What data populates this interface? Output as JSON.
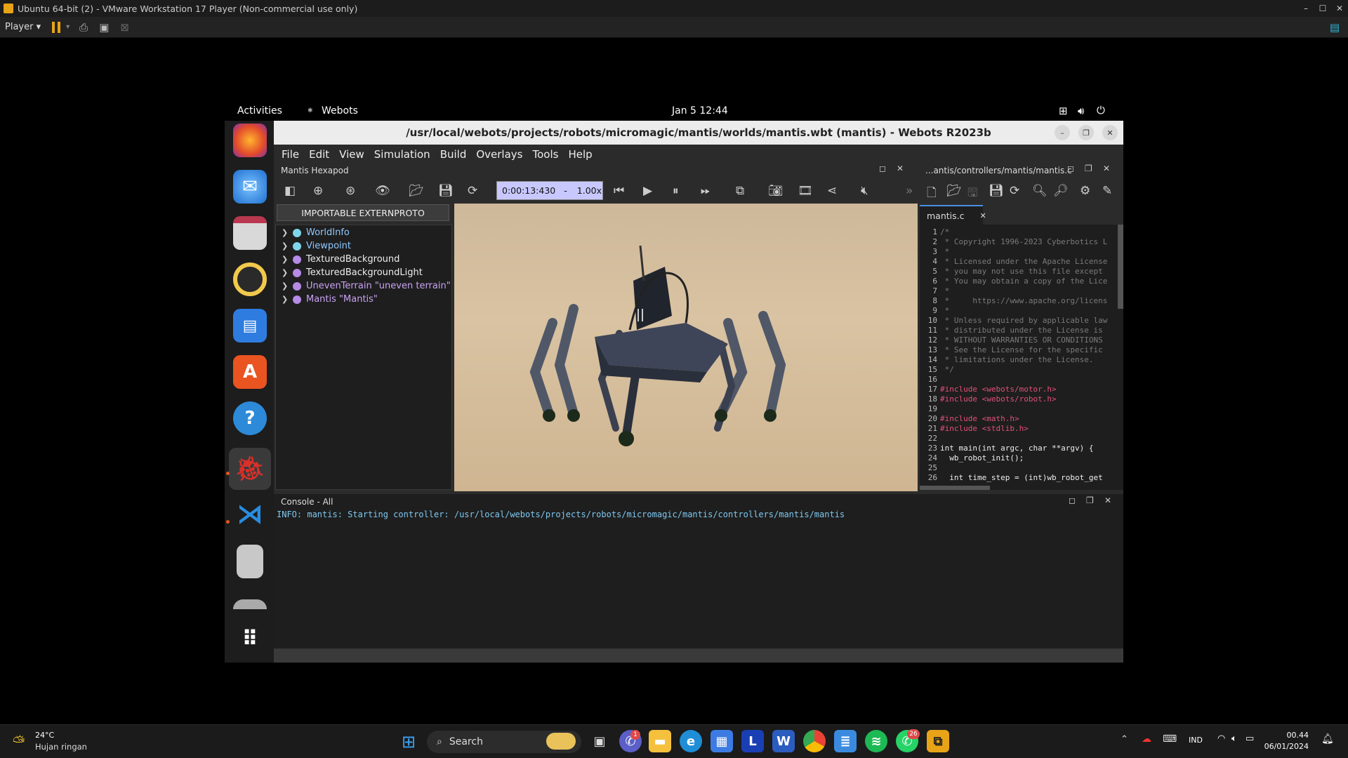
{
  "vmware": {
    "title": "Ubuntu 64-bit (2) - VMware Workstation 17 Player (Non-commercial use only)",
    "player_menu": "Player",
    "window_buttons": [
      "–",
      "☐",
      "✕"
    ]
  },
  "ubuntu": {
    "activities": "Activities",
    "app_name": "Webots",
    "clock": "Jan 5  12:44"
  },
  "webots": {
    "window_title": "/usr/local/webots/projects/robots/micromagic/mantis/worlds/mantis.wbt (mantis) - Webots R2023b",
    "menus": [
      "File",
      "Edit",
      "View",
      "Simulation",
      "Build",
      "Overlays",
      "Tools",
      "Help"
    ],
    "scene_panel_title": "Mantis Hexapod",
    "editor_panel_title": "...antis/controllers/mantis/mantis.c",
    "sim_time": "0:00:13:430",
    "speed": "1.00x",
    "speed_sep": "-",
    "extern_button": "IMPORTABLE EXTERNPROTO",
    "tree": [
      {
        "label": "WorldInfo",
        "color": "#7fd5ea",
        "text_color": "#8fc8ff"
      },
      {
        "label": "Viewpoint",
        "color": "#7fd5ea",
        "text_color": "#8fc8ff"
      },
      {
        "label": "TexturedBackground",
        "color": "#b68ae6",
        "text_color": "#eeeeee"
      },
      {
        "label": "TexturedBackgroundLight",
        "color": "#b68ae6",
        "text_color": "#eeeeee"
      },
      {
        "label": "UnevenTerrain \"uneven terrain\"",
        "color": "#b68ae6",
        "text_color": "#c9a3f2"
      },
      {
        "label": "Mantis \"Mantis\"",
        "color": "#b68ae6",
        "text_color": "#c9a3f2"
      }
    ],
    "editor_tab": "mantis.c",
    "code": [
      {
        "n": "1",
        "t": "/*",
        "c": "#7a7a7a"
      },
      {
        "n": "2",
        "t": " * Copyright 1996-2023 Cyberbotics L",
        "c": "#7a7a7a"
      },
      {
        "n": "3",
        "t": " *",
        "c": "#7a7a7a"
      },
      {
        "n": "4",
        "t": " * Licensed under the Apache License",
        "c": "#7a7a7a"
      },
      {
        "n": "5",
        "t": " * you may not use this file except",
        "c": "#7a7a7a"
      },
      {
        "n": "6",
        "t": " * You may obtain a copy of the Lice",
        "c": "#7a7a7a"
      },
      {
        "n": "7",
        "t": " *",
        "c": "#7a7a7a"
      },
      {
        "n": "8",
        "t": " *     https://www.apache.org/licens",
        "c": "#7a7a7a"
      },
      {
        "n": "9",
        "t": " *",
        "c": "#7a7a7a"
      },
      {
        "n": "10",
        "t": " * Unless required by applicable law",
        "c": "#7a7a7a"
      },
      {
        "n": "11",
        "t": " * distributed under the License is",
        "c": "#7a7a7a"
      },
      {
        "n": "12",
        "t": " * WITHOUT WARRANTIES OR CONDITIONS",
        "c": "#7a7a7a"
      },
      {
        "n": "13",
        "t": " * See the License for the specific",
        "c": "#7a7a7a"
      },
      {
        "n": "14",
        "t": " * limitations under the License.",
        "c": "#7a7a7a"
      },
      {
        "n": "15",
        "t": " */",
        "c": "#7a7a7a"
      },
      {
        "n": "16",
        "t": "",
        "c": "#dddddd"
      },
      {
        "n": "17",
        "t": "#include <webots/motor.h>",
        "c": "#e0507a"
      },
      {
        "n": "18",
        "t": "#include <webots/robot.h>",
        "c": "#e0507a"
      },
      {
        "n": "19",
        "t": "",
        "c": "#dddddd"
      },
      {
        "n": "20",
        "t": "#include <math.h>",
        "c": "#e0507a"
      },
      {
        "n": "21",
        "t": "#include <stdlib.h>",
        "c": "#e0507a"
      },
      {
        "n": "22",
        "t": "",
        "c": "#dddddd"
      },
      {
        "n": "23",
        "t": "int main(int argc, char **argv) {",
        "c": "#eeeeee"
      },
      {
        "n": "24",
        "t": "  wb_robot_init();",
        "c": "#eeeeee"
      },
      {
        "n": "25",
        "t": "",
        "c": "#dddddd"
      },
      {
        "n": "26",
        "t": "  int time_step = (int)wb_robot_get",
        "c": "#eeeeee"
      }
    ],
    "console_title": "Console - All",
    "console_text": "INFO: mantis: Starting controller: /usr/local/webots/projects/robots/micromagic/mantis/controllers/mantis/mantis"
  },
  "windows": {
    "weather_temp": "24°C",
    "weather_desc": "Hujan ringan",
    "search": "Search",
    "lang": "IND",
    "time": "00.44",
    "date": "06/01/2024",
    "teams_badge": "1",
    "whatsapp_badge": "26"
  }
}
